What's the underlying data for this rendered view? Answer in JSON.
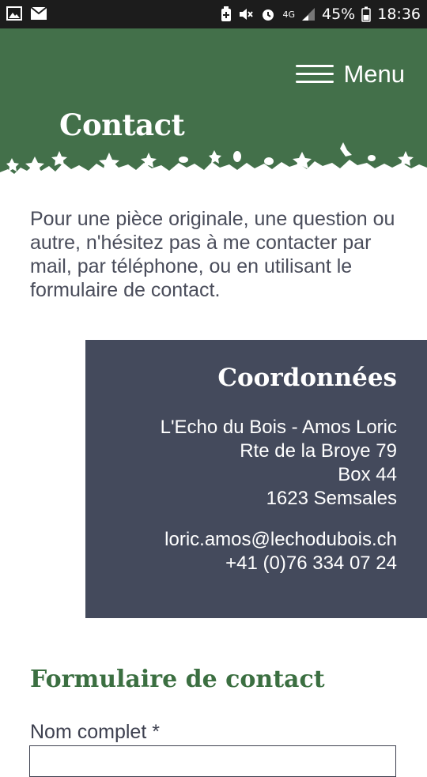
{
  "status_bar": {
    "battery": "45%",
    "time": "18:36",
    "network": "4G",
    "icons": [
      "image-icon",
      "mail-icon",
      "battery-saver-icon",
      "mute-icon",
      "alarm-icon",
      "signal-icon",
      "battery-icon"
    ]
  },
  "header": {
    "menu_label": "Menu",
    "title": "Contact",
    "background_color": "#43704a"
  },
  "intro": {
    "text": "Pour une pièce originale, une question ou autre, n'hésitez pas à me contacter par mail, par téléphone, ou en utilisant le formulaire de contact."
  },
  "coordinates": {
    "title": "Coordonnées",
    "name": "L'Echo du Bois - Amos Loric",
    "street": "Rte de la Broye 79",
    "box": "Box 44",
    "city": "1623 Semsales",
    "email": "loric.amos@lechodubois.ch",
    "phone": "+41 (0)76 334 07 24",
    "background_color": "#444a5c"
  },
  "form": {
    "title": "Formulaire de contact",
    "fields": [
      {
        "label": "Nom complet *",
        "value": ""
      }
    ],
    "title_color": "#3b6f41"
  }
}
